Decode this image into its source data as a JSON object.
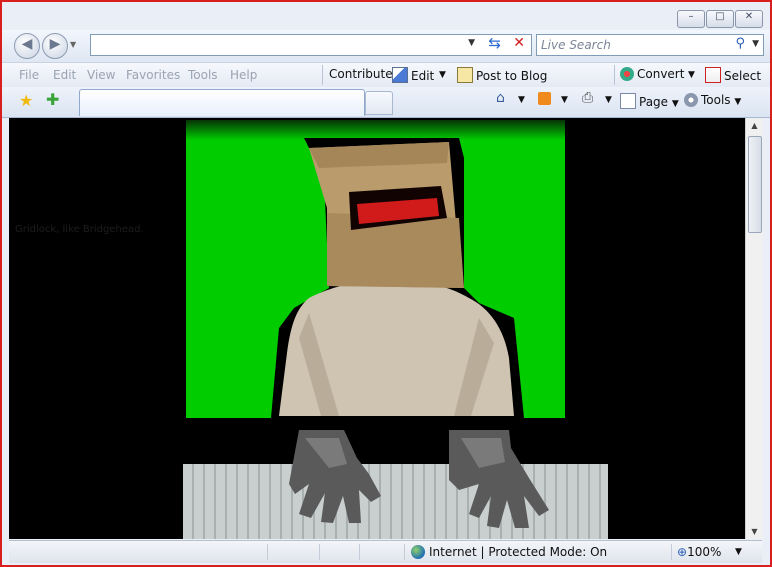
{
  "window": {
    "controls": {
      "minimize": "–",
      "restore": "□",
      "close": "✕"
    }
  },
  "nav": {
    "back_icon": "back-arrow-icon",
    "forward_icon": "forward-arrow-icon",
    "address_value": "",
    "search_placeholder": "Live Search"
  },
  "menu": {
    "items": [
      "File",
      "Edit",
      "View",
      "Favorites",
      "Tools",
      "Help"
    ],
    "contribute": "Contribute",
    "edit": "Edit",
    "post_to_blog": "Post to Blog",
    "convert": "Convert",
    "select": "Select"
  },
  "commands": {
    "page": "Page",
    "tools": "Tools"
  },
  "content": {
    "faint_link": "Gridlock, like Bridgehead.",
    "background": "#000000",
    "greenscreen": "#00cc00"
  },
  "status": {
    "zone": "Internet | Protected Mode: On",
    "zoom": "100%"
  },
  "colors": {
    "frame_border": "#d81e1e",
    "accent": "#2a6ad0"
  }
}
